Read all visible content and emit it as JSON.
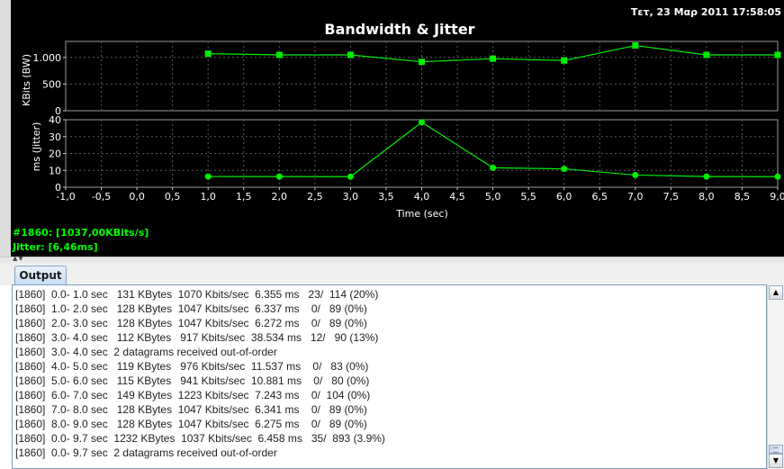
{
  "header": {
    "timestamp": "Τετ, 23 Μαρ 2011 17:58:05"
  },
  "chart_data": [
    {
      "type": "line",
      "title": "Bandwidth & Jitter",
      "ylabel": "KBits (BW)",
      "xlabel": "",
      "xlim": [
        -1.0,
        9.0
      ],
      "ylim": [
        0,
        1300
      ],
      "yticks": [
        "0",
        "500",
        "1.000"
      ],
      "grid": true,
      "marker": "square",
      "color": "#00ee00",
      "x": [
        1.0,
        2.0,
        3.0,
        4.0,
        5.0,
        6.0,
        7.0,
        8.0,
        9.0
      ],
      "values": [
        1070,
        1047,
        1047,
        917,
        976,
        941,
        1223,
        1047,
        1047
      ]
    },
    {
      "type": "line",
      "ylabel": "ms (Jitter)",
      "xlabel": "Time (sec)",
      "xlim": [
        -1.0,
        9.0
      ],
      "ylim": [
        0,
        40
      ],
      "yticks": [
        "0",
        "10",
        "20",
        "30",
        "40"
      ],
      "xticks": [
        "-1,0",
        "-0,5",
        "0,0",
        "0,5",
        "1,0",
        "1,5",
        "2,0",
        "2,5",
        "3,0",
        "3,5",
        "4,0",
        "4,5",
        "5,0",
        "5,5",
        "6,0",
        "6,5",
        "7,0",
        "7,5",
        "8,0",
        "8,5",
        "9,0"
      ],
      "grid": true,
      "marker": "circle",
      "color": "#00ee00",
      "x": [
        1.0,
        2.0,
        3.0,
        4.0,
        5.0,
        6.0,
        7.0,
        8.0,
        9.0
      ],
      "values": [
        6.355,
        6.337,
        6.272,
        38.534,
        11.537,
        10.881,
        7.243,
        6.341,
        6.275
      ]
    }
  ],
  "status": {
    "bandwidth": "#1860: [1037,00KBits/s]",
    "jitter": "Jitter: [6,46ms]"
  },
  "tabs": [
    {
      "label": "Output"
    }
  ],
  "output": {
    "lines": [
      "[1860]  0.0- 1.0 sec   131 KBytes  1070 Kbits/sec  6.355 ms   23/  114 (20%)",
      "[1860]  1.0- 2.0 sec   128 KBytes  1047 Kbits/sec  6.337 ms    0/   89 (0%)",
      "[1860]  2.0- 3.0 sec   128 KBytes  1047 Kbits/sec  6.272 ms    0/   89 (0%)",
      "[1860]  3.0- 4.0 sec   112 KBytes   917 Kbits/sec  38.534 ms   12/   90 (13%)",
      "[1860]  3.0- 4.0 sec  2 datagrams received out-of-order",
      "[1860]  4.0- 5.0 sec   119 KBytes   976 Kbits/sec  11.537 ms    0/   83 (0%)",
      "[1860]  5.0- 6.0 sec   115 KBytes   941 Kbits/sec  10.881 ms    0/   80 (0%)",
      "[1860]  6.0- 7.0 sec   149 KBytes  1223 Kbits/sec  7.243 ms    0/  104 (0%)",
      "[1860]  7.0- 8.0 sec   128 KBytes  1047 Kbits/sec  6.341 ms    0/   89 (0%)",
      "[1860]  8.0- 9.0 sec   128 KBytes  1047 Kbits/sec  6.275 ms    0/   89 (0%)",
      "[1860]  0.0- 9.7 sec  1232 KBytes  1037 Kbits/sec  6.458 ms   35/  893 (3.9%)",
      "[1860]  0.0- 9.7 sec  2 datagrams received out-of-order"
    ]
  },
  "scrollbar": {
    "up_icon": "arrow-up-icon",
    "down_icon": "arrow-down-icon"
  }
}
